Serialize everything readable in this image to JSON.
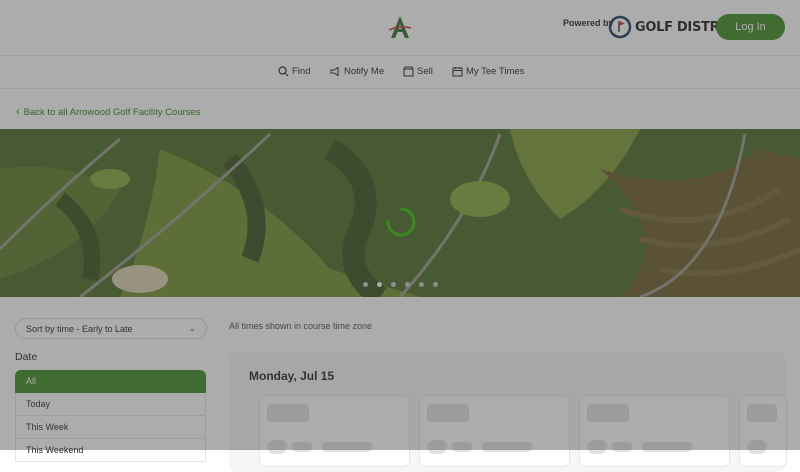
{
  "header": {
    "logo_letter": "A",
    "powered_by": "Powered by",
    "brand": "GOLF DISTRICT",
    "login_label": "Log In"
  },
  "nav": {
    "items": [
      {
        "label": "Find",
        "icon": "search-icon"
      },
      {
        "label": "Notify Me",
        "icon": "megaphone-icon"
      },
      {
        "label": "Sell",
        "icon": "storefront-icon"
      },
      {
        "label": "My Tee Times",
        "icon": "calendar-icon"
      }
    ]
  },
  "back_link": "Back to all Arrowood Golf Facility Courses",
  "hero": {
    "slide_count": 6,
    "active_slide": 2
  },
  "filters": {
    "sort_label": "Sort by time - Early to Late",
    "date_heading": "Date",
    "date_options": [
      "All",
      "Today",
      "This Week",
      "This Weekend"
    ],
    "selected_date": "All"
  },
  "results": {
    "timezone_note": "All times shown in course time zone",
    "day_label": "Monday, Jul 15"
  },
  "colors": {
    "accent": "#3b8a1f",
    "overlay": "#464646"
  }
}
